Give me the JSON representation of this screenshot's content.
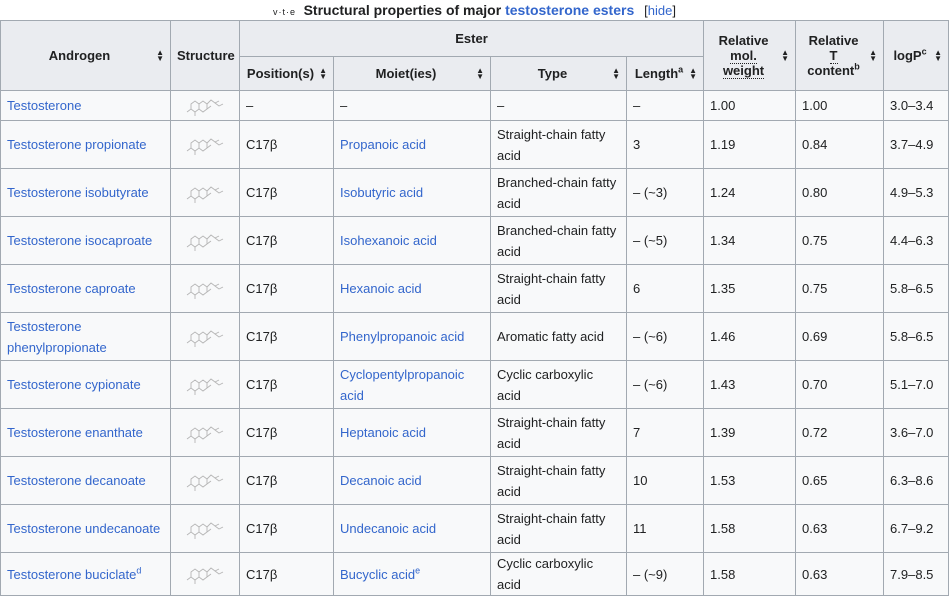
{
  "caption": {
    "navbox": [
      "v",
      "t",
      "e"
    ],
    "title_prefix": "Structural properties of major ",
    "title_link": "testosterone esters",
    "hide_open": "[",
    "hide_label": "hide",
    "hide_close": "]"
  },
  "headers": {
    "androgen": "Androgen",
    "structure": "Structure",
    "ester": "Ester",
    "positions": "Position(s)",
    "moieties": "Moiet(ies)",
    "type": "Type",
    "length": "Length",
    "length_note": "a",
    "rel_mol": "Relative",
    "rel_mol_2": "mol.",
    "rel_mol_3": "weight",
    "rel_t": "Relative",
    "rel_t_2": "T",
    "rel_t_3": "content",
    "rel_t_note": "b",
    "logp": "logP",
    "logp_note": "c"
  },
  "rows": [
    {
      "androgen": "Testosterone",
      "androgen_note": "",
      "position": "–",
      "moiety": "–",
      "moiety_link": false,
      "moiety_note": "",
      "type": "–",
      "length": "–",
      "mol": "1.00",
      "t": "1.00",
      "logp": "3.0–3.4"
    },
    {
      "androgen": "Testosterone propionate",
      "androgen_note": "",
      "position": "C17β",
      "moiety": "Propanoic acid",
      "moiety_link": true,
      "moiety_note": "",
      "type": "Straight-chain fatty acid",
      "length": "3",
      "mol": "1.19",
      "t": "0.84",
      "logp": "3.7–4.9"
    },
    {
      "androgen": "Testosterone isobutyrate",
      "androgen_note": "",
      "position": "C17β",
      "moiety": "Isobutyric acid",
      "moiety_link": true,
      "moiety_note": "",
      "type": "Branched-chain fatty acid",
      "length": "– (~3)",
      "mol": "1.24",
      "t": "0.80",
      "logp": "4.9–5.3"
    },
    {
      "androgen": "Testosterone isocaproate",
      "androgen_note": "",
      "position": "C17β",
      "moiety": "Isohexanoic acid",
      "moiety_link": true,
      "moiety_note": "",
      "type": "Branched-chain fatty acid",
      "length": "– (~5)",
      "mol": "1.34",
      "t": "0.75",
      "logp": "4.4–6.3"
    },
    {
      "androgen": "Testosterone caproate",
      "androgen_note": "",
      "position": "C17β",
      "moiety": "Hexanoic acid",
      "moiety_link": true,
      "moiety_note": "",
      "type": "Straight-chain fatty acid",
      "length": "6",
      "mol": "1.35",
      "t": "0.75",
      "logp": "5.8–6.5"
    },
    {
      "androgen": "Testosterone phenylpropionate",
      "androgen_note": "",
      "position": "C17β",
      "moiety": "Phenylpropanoic acid",
      "moiety_link": true,
      "moiety_note": "",
      "type": "Aromatic fatty acid",
      "length": "– (~6)",
      "mol": "1.46",
      "t": "0.69",
      "logp": "5.8–6.5"
    },
    {
      "androgen": "Testosterone cypionate",
      "androgen_note": "",
      "position": "C17β",
      "moiety": "Cyclopentylpropanoic acid",
      "moiety_link": true,
      "moiety_note": "",
      "type": "Cyclic carboxylic acid",
      "length": "– (~6)",
      "mol": "1.43",
      "t": "0.70",
      "logp": "5.1–7.0"
    },
    {
      "androgen": "Testosterone enanthate",
      "androgen_note": "",
      "position": "C17β",
      "moiety": "Heptanoic acid",
      "moiety_link": true,
      "moiety_note": "",
      "type": "Straight-chain fatty acid",
      "length": "7",
      "mol": "1.39",
      "t": "0.72",
      "logp": "3.6–7.0"
    },
    {
      "androgen": "Testosterone decanoate",
      "androgen_note": "",
      "position": "C17β",
      "moiety": "Decanoic acid",
      "moiety_link": true,
      "moiety_note": "",
      "type": "Straight-chain fatty acid",
      "length": "10",
      "mol": "1.53",
      "t": "0.65",
      "logp": "6.3–8.6"
    },
    {
      "androgen": "Testosterone undecanoate",
      "androgen_note": "",
      "position": "C17β",
      "moiety": "Undecanoic acid",
      "moiety_link": true,
      "moiety_note": "",
      "type": "Straight-chain fatty acid",
      "length": "11",
      "mol": "1.58",
      "t": "0.63",
      "logp": "6.7–9.2"
    },
    {
      "androgen": "Testosterone buciclate",
      "androgen_note": "d",
      "position": "C17β",
      "moiety": "Bucyclic acid",
      "moiety_link": true,
      "moiety_note": "e",
      "type": "Cyclic carboxylic acid",
      "length": "– (~9)",
      "mol": "1.58",
      "t": "0.63",
      "logp": "7.9–8.5"
    }
  ],
  "colors": {
    "link": "#3366cc",
    "header_bg": "#eaecf0",
    "cell_bg": "#f8f9fa",
    "border": "#a2a9b1"
  },
  "icons": {
    "sort": "sort-arrows-icon",
    "structure": "chemical-structure-thumbnail"
  }
}
